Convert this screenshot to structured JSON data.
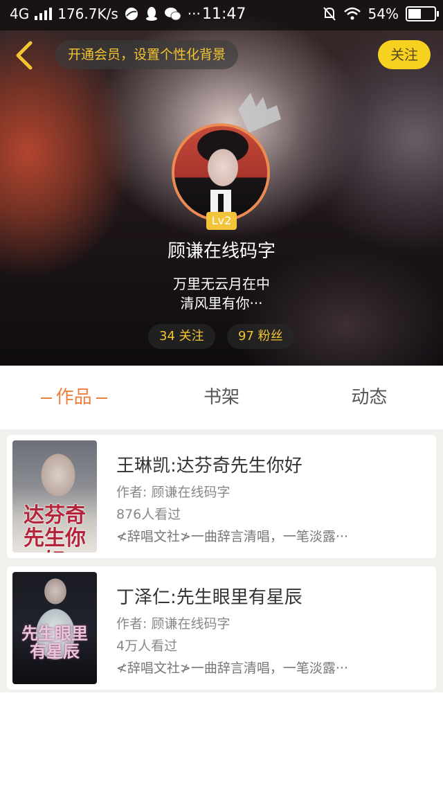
{
  "status_bar": {
    "network": "4G",
    "speed": "176.7K/s",
    "time": "11:47",
    "battery": "54%"
  },
  "header": {
    "vip_text": "开通会员，设置个性化背景",
    "follow_label": "关注"
  },
  "profile": {
    "level": "Lv2",
    "username": "顾谦在线码字",
    "bio_line1": "万里无云月在中",
    "bio_line2": "清风里有你···",
    "following": "34 关注",
    "fans": "97 粉丝"
  },
  "tabs": [
    {
      "label": "作品",
      "active": true
    },
    {
      "label": "书架",
      "active": false
    },
    {
      "label": "动态",
      "active": false
    }
  ],
  "books": [
    {
      "title": "王琳凯:达芬奇先生你好",
      "author": "作者: 顾谦在线码字",
      "views": "876人看过",
      "desc": "≮辞唱文社≯一曲辞言清唱，一笔淡露···",
      "cover_text": "达芬奇先生你好"
    },
    {
      "title": "丁泽仁:先生眼里有星辰",
      "author": "作者: 顾谦在线码字",
      "views": "4万人看过",
      "desc": "≮辞唱文社≯一曲辞言清唱，一笔淡露···",
      "cover_text": "先生眼里有星辰"
    }
  ],
  "colors": {
    "accent": "#ef7e3c",
    "follow_bg": "#f7d11f",
    "gold_text": "#f2c531"
  }
}
